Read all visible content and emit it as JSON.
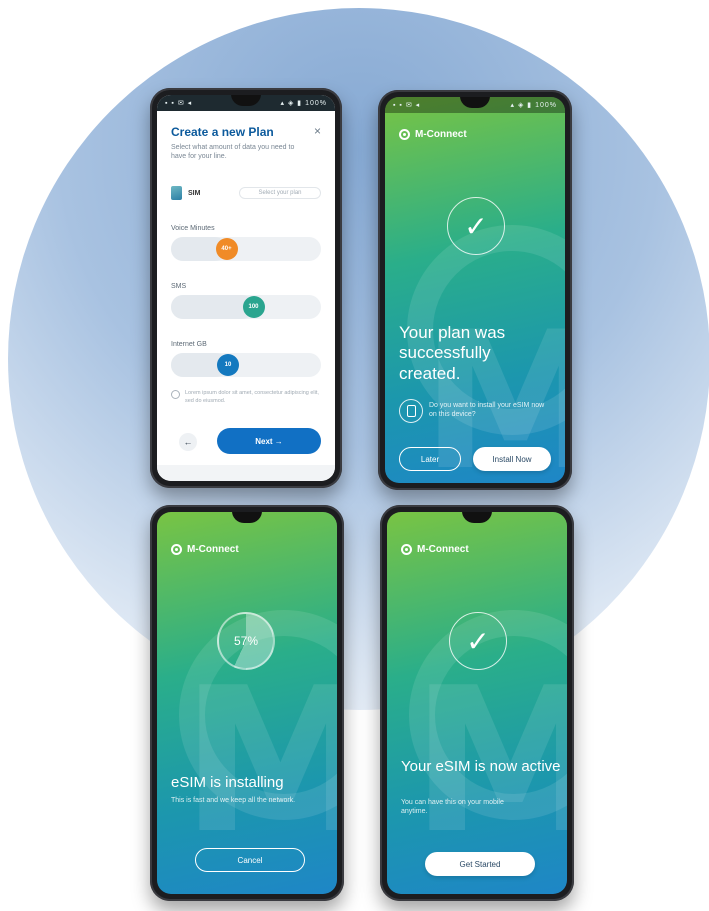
{
  "status": {
    "left": "▪ ▪ ✉ ◂",
    "right": "▴ ◈ ▮ 100%"
  },
  "brand": "M-Connect",
  "screen1": {
    "title": "Create a new Plan",
    "close": "×",
    "description": "Select what amount of data you need to have for your line.",
    "sim": {
      "label": "SIM",
      "value": "Select your plan"
    },
    "sliders": [
      {
        "label": "Voice Minutes",
        "value_text": "40+",
        "level": 0.37,
        "color": "#f08b27"
      },
      {
        "label": "SMS",
        "value_text": "100",
        "level": 0.55,
        "color": "#2aa58f"
      },
      {
        "label": "Internet GB",
        "value_text": "10",
        "level": 0.38,
        "color": "#1479bf"
      }
    ],
    "note": "Lorem ipsum dolor sit amet, consectetur adipiscing elit, sed do eiusmod.",
    "back": "←",
    "next": "Next →"
  },
  "screen2": {
    "check": "✓",
    "headline": "Your plan was successfully created.",
    "info": "Do you want to install your eSIM now on this device?",
    "later": "Later",
    "install": "Install Now"
  },
  "screen3": {
    "percent": "57%",
    "progress": 0.57,
    "headline": "eSIM is installing",
    "subtext": "This is fast and we keep all the network.",
    "cancel": "Cancel"
  },
  "screen4": {
    "check": "✓",
    "headline": "Your eSIM is now active",
    "subtext": "You can have this on your mobile anytime.",
    "cta": "Get Started"
  }
}
